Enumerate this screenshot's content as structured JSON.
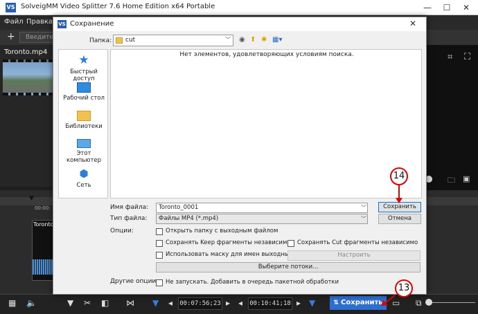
{
  "app": {
    "title": "SolveigMM Video Splitter 7.6 Home Edition x64 Portable",
    "logo": "VS",
    "menu": [
      "Файл",
      "Правка"
    ],
    "toolbar": {
      "add": "+",
      "input_placeholder": "Введите"
    },
    "file_name": "Toronto.mp4",
    "clip_label": "Toronto.mp4",
    "ruler_time": "00:00:",
    "time_start": "00:07:56;23",
    "time_end": "00:10:41;18",
    "save_label": "Сохранить"
  },
  "dialog": {
    "title": "Сохранение",
    "logo": "VS",
    "folder_label": "Папка:",
    "folder_value": "cut",
    "empty_message": "Нет элементов, удовлетворяющих условиям поиска.",
    "places": [
      {
        "label": "Быстрый доступ",
        "icon": "star-icon"
      },
      {
        "label": "Рабочий стол",
        "icon": "desktop-icon"
      },
      {
        "label": "Библиотеки",
        "icon": "library-icon"
      },
      {
        "label": "Этот компьютер",
        "icon": "computer-icon"
      },
      {
        "label": "Сеть",
        "icon": "network-icon"
      }
    ],
    "filename_label": "Имя файла:",
    "filename_value": "Toronto_0001",
    "filetype_label": "Тип файла:",
    "filetype_value": "Файлы MP4 (*.mp4)",
    "save_button": "Сохранить",
    "cancel_button": "Отмена",
    "options_label": "Опции:",
    "opt_open_folder": "Открыть папку с выходным файлом",
    "opt_save_keep": "Сохранять Keep фрагменты независимо",
    "opt_save_cut": "Сохранять Cut фрагменты независимо",
    "opt_mask": "Использовать маску для имен выходных файлов",
    "configure_button": "Настроить",
    "streams_button": "Выберите потоки...",
    "other_label": "Другие опции:",
    "opt_no_start": "Не запускать. Добавить в очередь пакетной обработки"
  },
  "annotations": {
    "badge_14": "14",
    "badge_13": "13",
    "color": "#e00000"
  }
}
